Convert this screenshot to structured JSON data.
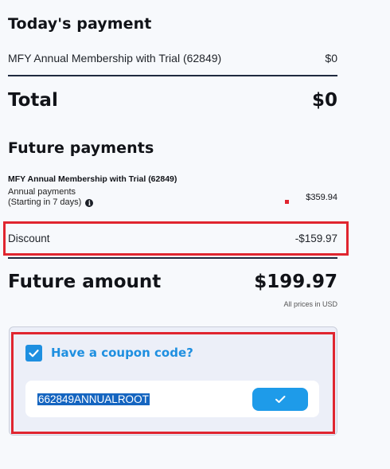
{
  "today": {
    "title": "Today's payment",
    "item_name": "MFY Annual Membership with Trial (62849)",
    "item_price": "$0"
  },
  "total": {
    "label": "Total",
    "value": "$0"
  },
  "future": {
    "title": "Future payments",
    "item_name": "MFY Annual Membership with Trial (62849)",
    "billing_line1": "Annual payments",
    "billing_line2": "(Starting in 7 days)",
    "item_price": "$359.94",
    "discount_label": "Discount",
    "discount_value": "-$159.97",
    "amount_label": "Future amount",
    "amount_value": "$199.97",
    "currency_note": "All prices in USD"
  },
  "coupon": {
    "checkbox_checked": true,
    "label": "Have a coupon code?",
    "code_value": "662849ANNUALROOT"
  },
  "colors": {
    "accent_blue": "#1e8fe0",
    "highlight_red": "#e0252f",
    "text_dark": "#111318"
  },
  "icons": {
    "info": "info-icon",
    "checkbox": "checkmark-icon",
    "apply": "checkmark-icon"
  }
}
